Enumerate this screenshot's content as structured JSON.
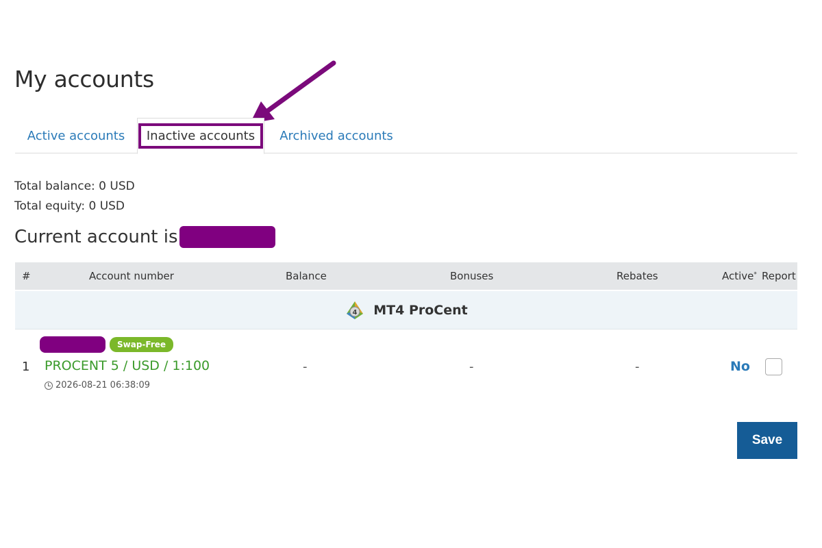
{
  "page": {
    "title": "My accounts"
  },
  "tabs": [
    {
      "label": "Active accounts",
      "selected": false
    },
    {
      "label": "Inactive accounts",
      "selected": true
    },
    {
      "label": "Archived accounts",
      "selected": false
    }
  ],
  "summary": {
    "total_balance": "Total balance: 0 USD",
    "total_equity": "Total equity: 0 USD"
  },
  "current_account": {
    "label": "Current account is"
  },
  "table": {
    "headers": {
      "num": "#",
      "account_number": "Account number",
      "balance": "Balance",
      "bonuses": "Bonuses",
      "rebates": "Rebates",
      "active": "Active",
      "active_mark": "*",
      "report": "Report"
    },
    "group": {
      "label": "MT4 ProCent",
      "icon": "mt4-icon"
    },
    "rows": [
      {
        "num": "1",
        "badge": "Swap-Free",
        "name": "PROCENT 5 / USD / 1:100",
        "date": "2026-08-21 06:38:09",
        "balance": "-",
        "bonuses": "-",
        "rebates": "-",
        "active": "No",
        "report_checked": false
      }
    ]
  },
  "actions": {
    "save_label": "Save"
  },
  "colors": {
    "link": "#2a7ab8",
    "annotation": "#7b0a7b",
    "account_green": "#3a9a2a",
    "badge_green": "#7bb82a",
    "save_button": "#155c96"
  }
}
